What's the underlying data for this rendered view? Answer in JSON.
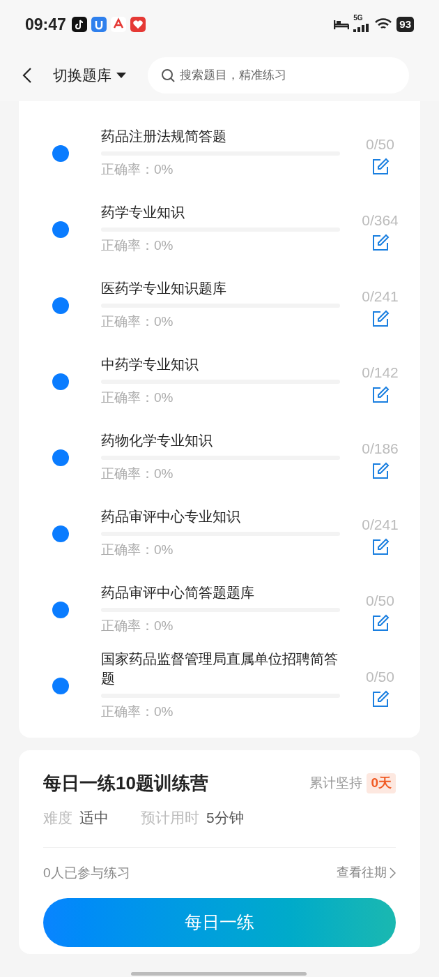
{
  "status_bar": {
    "time": "09:47",
    "network": "5G",
    "battery": "93"
  },
  "header": {
    "title": "切换题库",
    "search": {
      "placeholder": "搜索题目，精准练习"
    }
  },
  "banks": [
    {
      "title": "药品注册法规简答题",
      "accuracy": "正确率：0%",
      "count": "0/50",
      "level": 0
    },
    {
      "title": "药学专业知识",
      "accuracy": "正确率：0%",
      "count": "0/364",
      "level": 0
    },
    {
      "title": "医药学专业知识题库",
      "accuracy": "正确率：0%",
      "count": "0/241",
      "level": 0
    },
    {
      "title": "中药学专业知识",
      "accuracy": "正确率：0%",
      "count": "0/142",
      "level": 0
    },
    {
      "title": "药物化学专业知识",
      "accuracy": "正确率：0%",
      "count": "0/186",
      "level": 0
    },
    {
      "title": "药品审评中心专业知识",
      "accuracy": "正确率：0%",
      "count": "0/241",
      "level": 0
    },
    {
      "title": "药品审评中心简答题题库",
      "accuracy": "正确率：0%",
      "count": "0/50",
      "level": 0
    },
    {
      "title": "国家药品监督管理局直属单位招聘简答题",
      "accuracy": "正确率：0%",
      "count": "0/50",
      "level": 0
    }
  ],
  "camp": {
    "title": "每日一练10题训练营",
    "streak_label": "累计坚持",
    "streak_value": "0天",
    "difficulty_label": "难度",
    "difficulty": "适中",
    "time_label": "预计用时",
    "time": "5分钟",
    "participants": "0人已参与练习",
    "history_link": "查看往期",
    "button": "每日一练"
  }
}
